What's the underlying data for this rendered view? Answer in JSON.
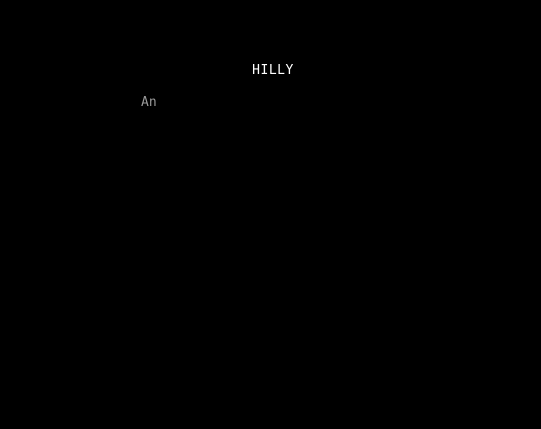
{
  "screen": {
    "title": "HILLY",
    "text_line": "An",
    "colors": {
      "background": "#000000",
      "title": "#ffffff",
      "text": "#9a9a9a"
    }
  }
}
